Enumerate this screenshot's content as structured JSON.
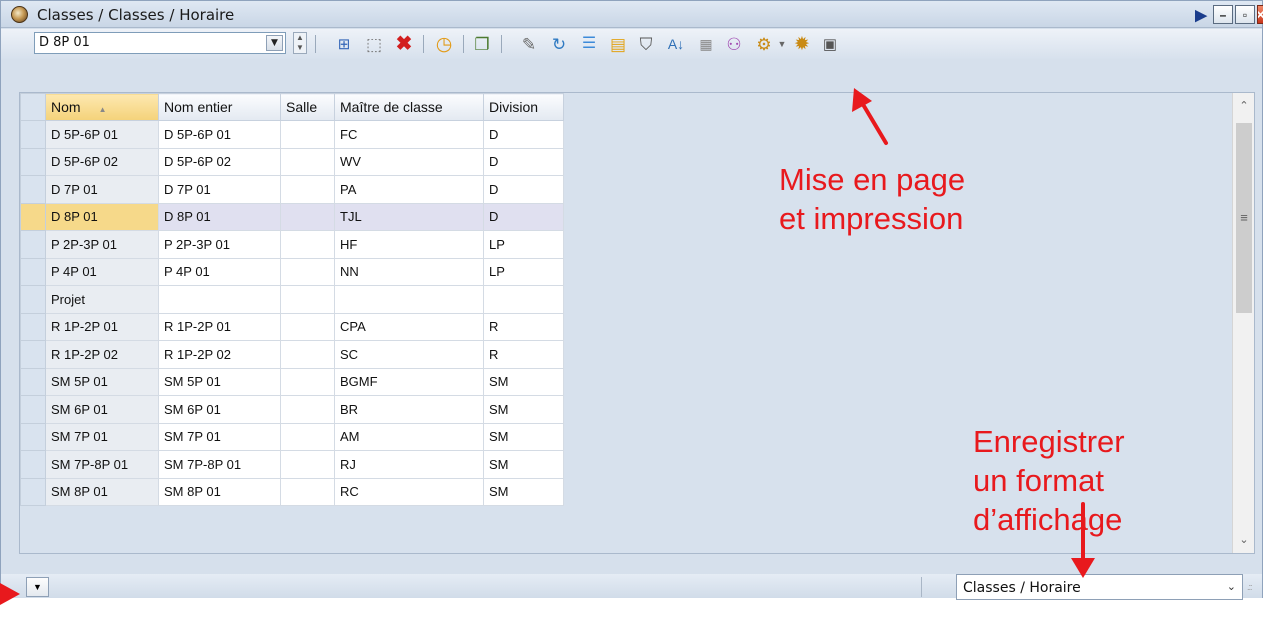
{
  "window": {
    "title": "Classes / Classes / Horaire"
  },
  "selector": {
    "value": "D 8P 01"
  },
  "grid": {
    "columns": [
      "Nom",
      "Nom entier",
      "Salle",
      "Maître de classe",
      "Division"
    ],
    "rows": [
      [
        "D 5P-6P 01",
        "D 5P-6P 01",
        "",
        "FC",
        "D"
      ],
      [
        "D 5P-6P 02",
        "D 5P-6P 02",
        "",
        "WV",
        "D"
      ],
      [
        "D 7P 01",
        "D 7P 01",
        "",
        "PA",
        "D"
      ],
      [
        "D 8P 01",
        "D 8P 01",
        "",
        "TJL",
        "D"
      ],
      [
        "P 2P-3P 01",
        "P 2P-3P 01",
        "",
        "HF",
        "LP"
      ],
      [
        "P 4P 01",
        "P 4P 01",
        "",
        "NN",
        "LP"
      ],
      [
        "Projet",
        "",
        "",
        "",
        ""
      ],
      [
        "R 1P-2P 01",
        "R 1P-2P 01",
        "",
        "CPA",
        "R"
      ],
      [
        "R 1P-2P 02",
        "R 1P-2P 02",
        "",
        "SC",
        "R"
      ],
      [
        "SM 5P 01",
        "SM 5P 01",
        "",
        "BGMF",
        "SM"
      ],
      [
        "SM 6P 01",
        "SM 6P 01",
        "",
        "BR",
        "SM"
      ],
      [
        "SM 7P 01",
        "SM 7P 01",
        "",
        "AM",
        "SM"
      ],
      [
        "SM 7P-8P 01",
        "SM 7P-8P 01",
        "",
        "RJ",
        "SM"
      ],
      [
        "SM 8P 01",
        "SM 8P 01",
        "",
        "RC",
        "SM"
      ]
    ],
    "selected_row": 3
  },
  "status": {
    "format_value": "Classes / Horaire"
  },
  "annotations": {
    "print_line1": "Mise en page",
    "print_line2": "et impression",
    "format_line1": "Enregistrer",
    "format_line2": "un format",
    "format_line3": "d’affichage"
  },
  "colors": {
    "annotation": "#e8191d",
    "selected_row": "#f6d98a"
  }
}
